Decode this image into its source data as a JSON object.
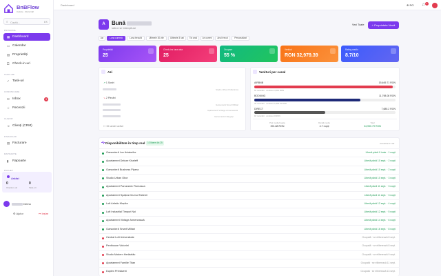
{
  "brand": {
    "name": "BnBFlow",
    "subtitle": "Cazare · Rezervări"
  },
  "search": {
    "placeholder": "Caută...",
    "shortcut": "⌘K"
  },
  "sidebar": {
    "sections": [
      "PRINCIPAL",
      "TASK-URI",
      "COMUNICARE",
      "CLIENȚI",
      "FINANCIAR",
      "RAPOARTE"
    ],
    "items": [
      {
        "label": "Dashboard",
        "icon": "grid-icon"
      },
      {
        "label": "Calendar",
        "icon": "calendar-icon"
      },
      {
        "label": "Proprietăți",
        "icon": "building-icon"
      },
      {
        "label": "Check-in-uri",
        "icon": "key-icon"
      },
      {
        "label": "Task-uri",
        "icon": "check-icon"
      },
      {
        "label": "Inbox",
        "icon": "inbox-icon",
        "badge": "3"
      },
      {
        "label": "Recenzii",
        "icon": "star-icon"
      },
      {
        "label": "Clienți (CRM)",
        "icon": "users-icon"
      },
      {
        "label": "Facturare",
        "icon": "invoice-icon"
      },
      {
        "label": "Rapoarte",
        "icon": "chart-icon"
      }
    ],
    "activity": {
      "section": "PACHET",
      "title": "Astăzi",
      "left_label": "Check-in-uri",
      "left_value": "0",
      "right_label": "Task-uri",
      "right_value": "0"
    },
    "user": {
      "name": "Demo"
    },
    "footer": {
      "help": "Ajutor",
      "logout": "Ieșire"
    }
  },
  "topbar": {
    "breadcrumb": "Dashboard",
    "lang": "RO",
    "notifications": "1"
  },
  "greeting": {
    "avatar_letter": "A",
    "title": "Bună",
    "subtitle": "Iată ce se întâmplă azi",
    "view_all": "Vezi Toate",
    "add_button": "+ Proprietate Nouă"
  },
  "filters": [
    "Azi",
    "Luna curentă",
    "Luna trecută",
    "Ultimele 30 zile",
    "Ultimele 3 luni",
    "Tot anul",
    "An curent",
    "Anul trecut",
    "Personalizat"
  ],
  "kpis": [
    {
      "label": "Proprietăți",
      "value": "25",
      "color": "#7c3aed"
    },
    {
      "label": "Check-ins luna asta",
      "value": "25",
      "color": "#e11d63"
    },
    {
      "label": "Ocupare",
      "value": "55 %",
      "color": "#10b981"
    },
    {
      "label": "Venituri",
      "value": "RON 32,979.39",
      "color": "#f97316"
    },
    {
      "label": "Rating mediu",
      "value": "8.7/10",
      "color": "#3b5bfd"
    }
  ],
  "today": {
    "title": "Azi",
    "checkin": "1 Sosiri",
    "checkout": "2 Plecări",
    "tasks": "15 sarcini active",
    "rows": [
      "Studio Urban Politehnica",
      "Garsonieră Smart Militari",
      "Apartament Vintage Armenească",
      "Garsonieră Crângași"
    ]
  },
  "channels": {
    "title": "Venituri per canal",
    "rows": [
      {
        "name": "AIRBNB",
        "value": "15,469.71 RON",
        "pct": 0.98,
        "sub": "51 rezervări · comision 3,412 RON",
        "color": "#e23b4e"
      },
      {
        "name": "BOOKING",
        "value": "11,798.08 RON",
        "pct": 0.75,
        "sub": "43 rezervări · comision 1,804.75 RON",
        "color": "#1e2a78"
      },
      {
        "name": "DIRECT",
        "value": "7,685.2 RON",
        "pct": 0.5,
        "sub": "18 rezervări · comision 0 RON",
        "color": "#555"
      }
    ],
    "stats": [
      {
        "label": "Preț mediu/noapte",
        "value": "391.88 RON"
      },
      {
        "label": "Durată medie",
        "value": "4.7 nopți"
      },
      {
        "label": "Total",
        "value": "34,950.79 RON"
      }
    ]
  },
  "availability": {
    "title": "Disponibilitate în timp real",
    "badge": "10 libere din 25",
    "updated": "Actualizat 17:02",
    "rows": [
      {
        "name": "Garsonieră Lux Aviatorilor",
        "status": "Liberă până 9 iunie · 1 nopți",
        "free": true
      },
      {
        "name": "Apartament Deluxe Kiseleff",
        "status": "Liberă până 10 sept. · 2 nopți",
        "free": true
      },
      {
        "name": "Garsonieră Business Pipera",
        "status": "Liberă până 10 sept. · 2 nopți",
        "free": true
      },
      {
        "name": "Studio Urban Obor",
        "status": "Liberă până 10 sept. · 3 nopți",
        "free": true
      },
      {
        "name": "Apartament Panoramic Floreasca",
        "status": "Liberă până 11 sept. · 3 nopți",
        "free": true
      },
      {
        "name": "Apartament Spațios Drumul Taberei",
        "status": "Liberă până 11 sept. · 3 nopți",
        "free": true
      },
      {
        "name": "Loft Artistic Moșilor",
        "status": "Liberă până 12 sept. · 4 nopți",
        "free": true
      },
      {
        "name": "Loft Industrial Timpuri Noi",
        "status": "Liberă până 12 sept. · 5 nopți",
        "free": true
      },
      {
        "name": "Apartament Vintage Armenească",
        "status": "Liberă până 14 sept. · 6 nopți",
        "free": true
      },
      {
        "name": "Garsonieră Smart Militari",
        "status": "Liberă până 16 sept. · 8 nopți",
        "free": true
      },
      {
        "name": "Central Loft Universitate",
        "status": "Ocupată · se eliberează 8 sept.",
        "free": false
      },
      {
        "name": "Penthouse Victoriei",
        "status": "Ocupată · se eliberează 8 sept.",
        "free": false
      },
      {
        "name": "Studio Modern Herăstrău",
        "status": "Ocupată · se eliberează 9 sept.",
        "free": false
      },
      {
        "name": "Apartament Familie Titan",
        "status": "Ocupată · se eliberează 11 sept.",
        "free": false
      },
      {
        "name": "Duplex Primăverii",
        "status": "Ocupată · se eliberează 13 sept.",
        "free": false
      }
    ]
  },
  "colors": {
    "accent": "#7c3aed",
    "free": "#1d9b55",
    "occupied": "#e23b4e"
  }
}
